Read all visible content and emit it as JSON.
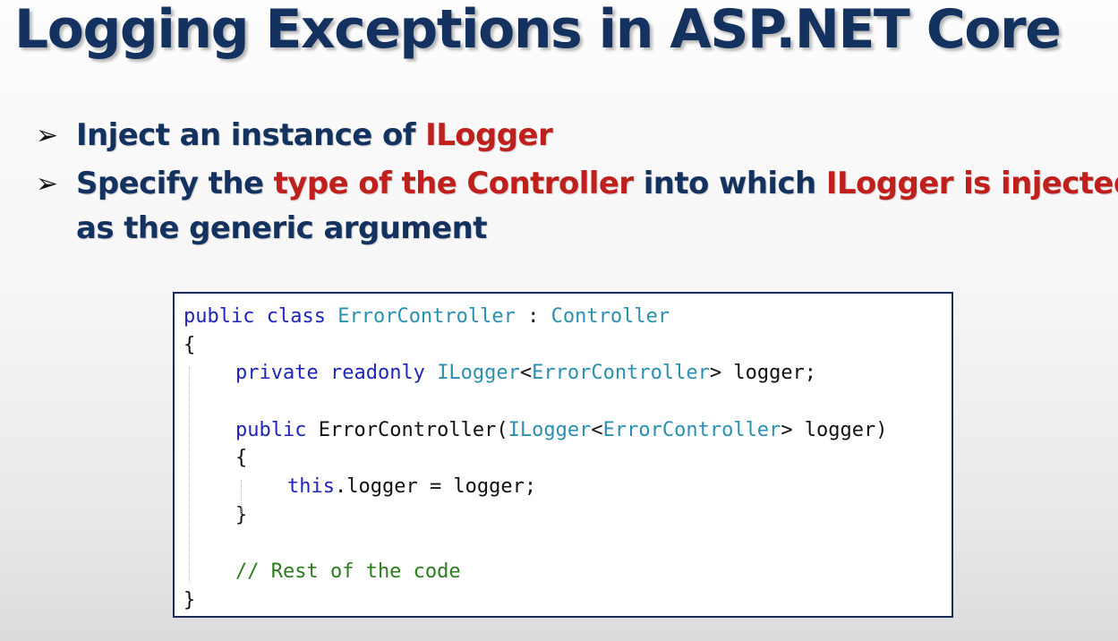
{
  "title": "Logging Exceptions in ASP.NET Core",
  "bullets": [
    {
      "parts": [
        "Inject an instance of ",
        "ILogger"
      ]
    },
    {
      "parts": [
        "Specify the ",
        "type of the Controller",
        " into which ",
        "ILogger is injected"
      ],
      "continuation": "as the generic argument"
    }
  ],
  "code": {
    "l1": {
      "a": "public",
      "b": "class",
      "c": "ErrorController",
      "d": " : ",
      "e": "Controller"
    },
    "l2": "{",
    "l3": {
      "a": "private",
      "b": "readonly",
      "c": "ILogger",
      "d": "<",
      "e": "ErrorController",
      "f": "> logger;"
    },
    "l5": {
      "a": "public",
      "b": " ErrorController(",
      "c": "ILogger",
      "d": "<",
      "e": "ErrorController",
      "f": "> logger)"
    },
    "l6": "{",
    "l7": {
      "a": "this",
      "b": ".logger = logger;"
    },
    "l8": "}",
    "l10": "// Rest of the code",
    "l11": "}"
  },
  "colors": {
    "title": "#13325f",
    "highlight": "#c0201c",
    "keyword": "#1f25b8",
    "type": "#2b8fb0",
    "comment": "#2a7d1c",
    "code_border": "#1c2a5a"
  },
  "icons": {
    "bullet": "arrowhead-bullet-icon"
  }
}
